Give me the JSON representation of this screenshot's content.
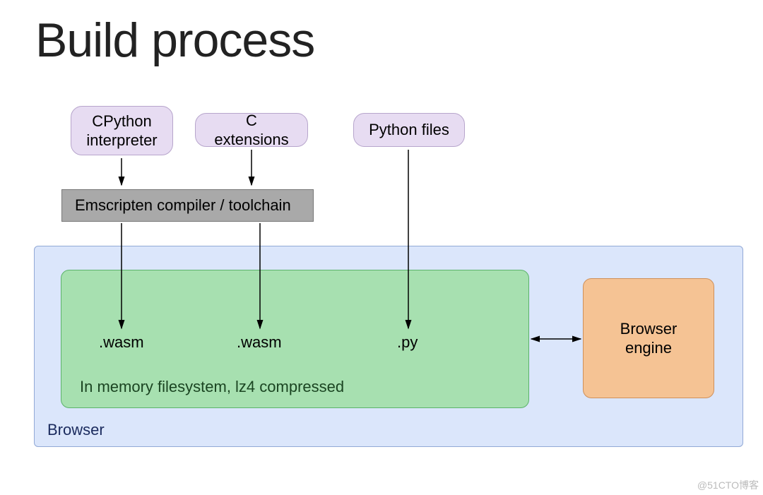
{
  "title": "Build process",
  "nodes": {
    "cpython": "CPython\ninterpreter",
    "cext": "C extensions",
    "pyfiles": "Python files",
    "emscripten": "Emscripten compiler / toolchain",
    "browser": "Browser",
    "filesystem_caption": "In memory filesystem, lz4 compressed",
    "wasm1": ".wasm",
    "wasm2": ".wasm",
    "py": ".py",
    "engine": "Browser\nengine"
  },
  "watermark": "@51CTO博客",
  "colors": {
    "pill_bg": "#e7dcf2",
    "emscripten_bg": "#a9a9a9",
    "browser_bg": "#dbe6fb",
    "filesystem_bg": "#a7e0b0",
    "engine_bg": "#f5c394"
  },
  "arrows": [
    {
      "from": "cpython",
      "to": "emscripten"
    },
    {
      "from": "cext",
      "to": "emscripten"
    },
    {
      "from": "emscripten",
      "to": "wasm1"
    },
    {
      "from": "emscripten",
      "to": "wasm2"
    },
    {
      "from": "pyfiles",
      "to": "py"
    },
    {
      "from": "filesystem",
      "to": "engine",
      "bidirectional": true
    }
  ]
}
